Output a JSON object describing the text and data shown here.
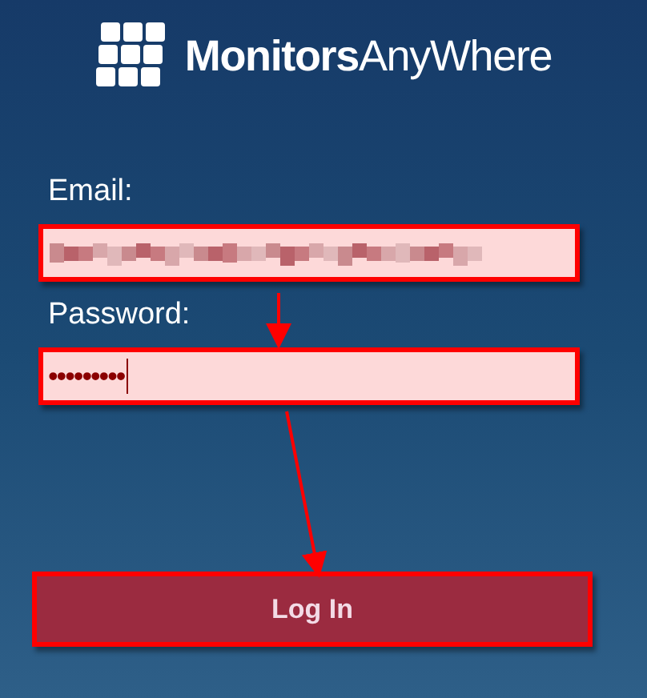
{
  "logo": {
    "bold_part": "Monitors",
    "regular_part": "AnyWhere"
  },
  "email": {
    "label": "Email:",
    "value_redacted": true
  },
  "password": {
    "label": "Password:",
    "value": "•••••••••"
  },
  "login_button": {
    "label": "Log In"
  }
}
